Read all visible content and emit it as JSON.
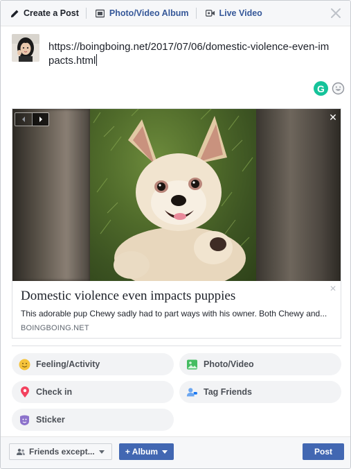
{
  "header": {
    "tabs": [
      {
        "label": "Create a Post",
        "icon": "pencil-icon"
      },
      {
        "label": "Photo/Video Album",
        "icon": "photo-album-icon"
      },
      {
        "label": "Live Video",
        "icon": "video-camera-icon"
      }
    ],
    "close_icon": "close-icon"
  },
  "composer": {
    "text": "https://boingboing.net/2017/07/06/domestic-violence-even-impacts.html"
  },
  "link_preview": {
    "title": "Domestic violence even impacts puppies",
    "description": "This adorable pup Chewy sadly had to part ways with his owner. Both Chewy and...",
    "domain": "BOINGBOING.NET",
    "close_glyph": "✕",
    "dismiss_glyph": "✕"
  },
  "actions": [
    {
      "label": "Feeling/Activity",
      "icon": "smiley-icon",
      "color": "#f5c33b"
    },
    {
      "label": "Photo/Video",
      "icon": "photo-icon",
      "color": "#45bd62"
    },
    {
      "label": "Check in",
      "icon": "location-pin-icon",
      "color": "#f3425f"
    },
    {
      "label": "Tag Friends",
      "icon": "tag-friends-icon",
      "color": "#1877f2"
    },
    {
      "label": "Sticker",
      "icon": "sticker-icon",
      "color": "#8c72cb"
    }
  ],
  "footer": {
    "privacy_label": "Friends except...",
    "album_label": "+ Album",
    "post_label": "Post"
  },
  "colors": {
    "brand": "#4267b2",
    "link": "#365899",
    "grammarly": "#15c39a"
  },
  "grammarly_glyph": "G"
}
